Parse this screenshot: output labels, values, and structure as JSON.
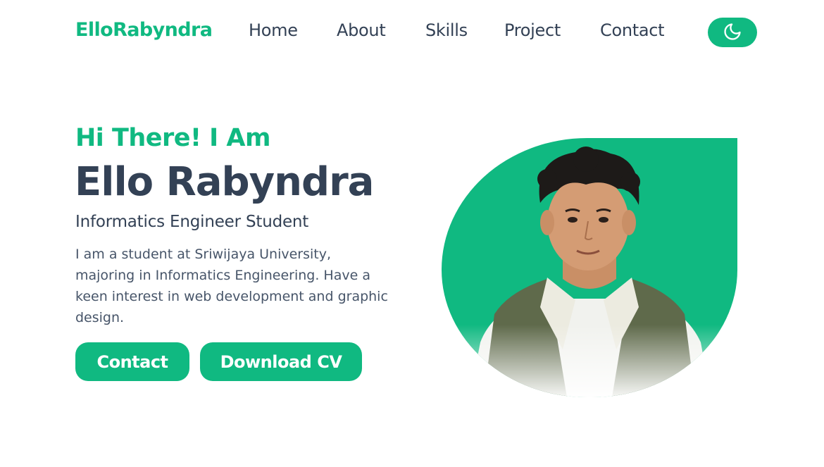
{
  "brand": "ElloRabyndra",
  "nav": {
    "items": [
      "Home",
      "About",
      "Skills",
      "Project",
      "Contact"
    ],
    "theme_toggle_icon": "moon-icon"
  },
  "hero": {
    "greeting": "Hi There! I Am",
    "name": "Ello Rabyndra",
    "role": "Informatics Engineer Student",
    "bio": "I am a student at Sriwijaya University, majoring in Informatics Engineering. Have a keen interest in web development and graphic design.",
    "buttons": {
      "contact": "Contact",
      "download_cv": "Download CV"
    }
  },
  "colors": {
    "accent": "#10b981",
    "text": "#334155",
    "muted": "#475569",
    "background": "#ffffff"
  }
}
